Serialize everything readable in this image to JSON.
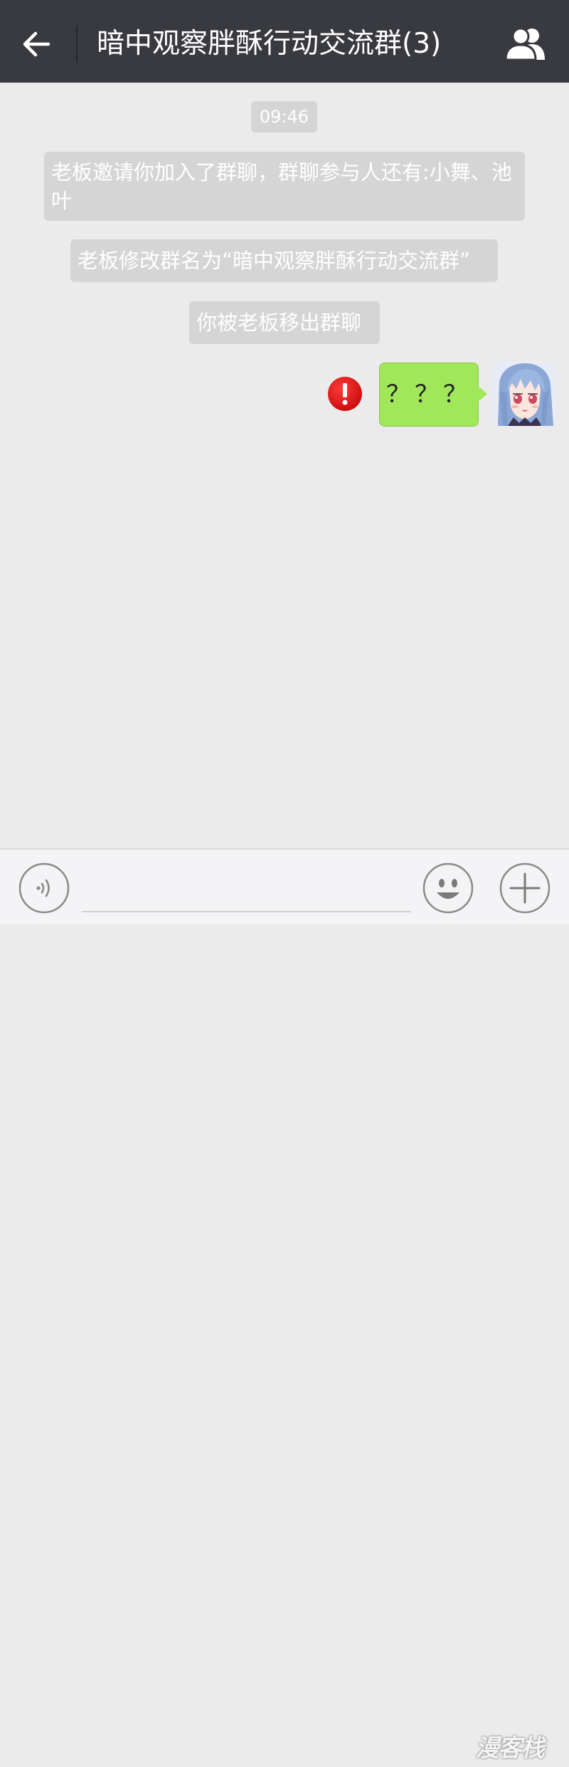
{
  "header": {
    "back_icon": "arrow-left-icon",
    "title": "暗中观察胖酥行动交流群(3)",
    "members_icon": "group-members-icon",
    "bg_color": "#393a3f"
  },
  "chat": {
    "timestamp": "09:46",
    "system_messages": [
      "老板邀请你加入了群聊，群聊参与人还有:小舞、池叶",
      "老板修改群名为“暗中观察胖酥行动交流群”",
      "你被老板移出群聊"
    ],
    "outgoing": {
      "text": "？？？",
      "status_icon": "send-failed-icon",
      "bubble_color": "#a0e75a",
      "avatar_icon": "anime-girl-avatar"
    }
  },
  "input_bar": {
    "voice_icon": "voice-input-icon",
    "emoji_icon": "emoji-smile-icon",
    "plus_icon": "plus-icon"
  },
  "watermark": {
    "text": "漫客栈"
  }
}
